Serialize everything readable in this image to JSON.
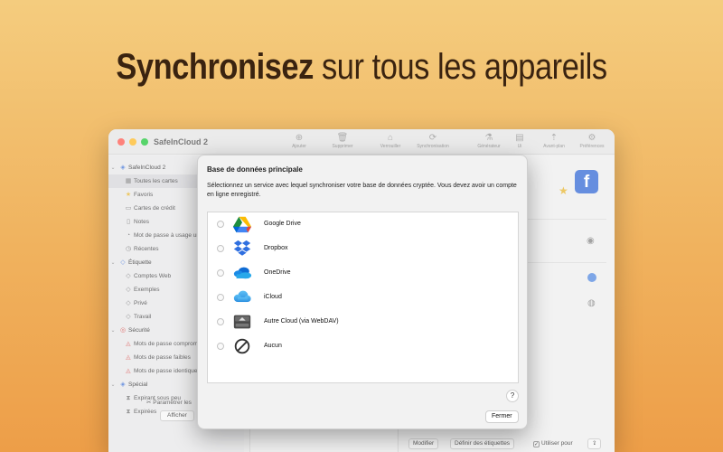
{
  "headline": {
    "bold": "Synchronisez",
    "rest": " sur tous les appareils"
  },
  "window": {
    "title": "SafeInCloud 2",
    "toolbar": [
      "Ajouter",
      "Supprimer",
      "Verrouiller",
      "Synchronisation",
      "Générateur",
      "Ui",
      "Avant-plan",
      "Préférences"
    ]
  },
  "sidebar": {
    "root": "SafeInCloud 2",
    "items": [
      "Toutes les cartes",
      "Favoris",
      "Cartes de crédit",
      "Notes",
      "Mot de passe à usage unique",
      "Récentes"
    ],
    "label_group": "Étiquette",
    "label_items": [
      "Comptes Web",
      "Exemples",
      "Privé",
      "Travail"
    ],
    "security_group": "Sécurité",
    "security_items": [
      "Mots de passe compromis",
      "Mots de passe faibles",
      "Mots de passe identiques"
    ],
    "special_group": "Spécial",
    "special_items": [
      "Expirant sous peu",
      "Expirées"
    ],
    "settings": "Paramétrer les",
    "show": "Afficher"
  },
  "bottombar": {
    "edit": "Modifier",
    "labels": "Définir des étiquettes",
    "use_for": "Utiliser pour"
  },
  "dialog": {
    "title": "Base de données principale",
    "description": "Sélectionnez un service avec lequel synchroniser votre base de données cryptée. Vous devez avoir un compte en ligne enregistré.",
    "options": [
      {
        "label": "Google Drive",
        "icon": "google-drive-icon"
      },
      {
        "label": "Dropbox",
        "icon": "dropbox-icon"
      },
      {
        "label": "OneDrive",
        "icon": "onedrive-icon"
      },
      {
        "label": "iCloud",
        "icon": "icloud-icon"
      },
      {
        "label": "Autre Cloud (via WebDAV)",
        "icon": "webdav-drive-icon"
      },
      {
        "label": "Aucun",
        "icon": "none-icon"
      }
    ],
    "help": "?",
    "close": "Fermer"
  },
  "colors": {
    "accent": "#3b6fd6",
    "background_top": "#f4cc7e",
    "background_bottom": "#ed9e48"
  }
}
